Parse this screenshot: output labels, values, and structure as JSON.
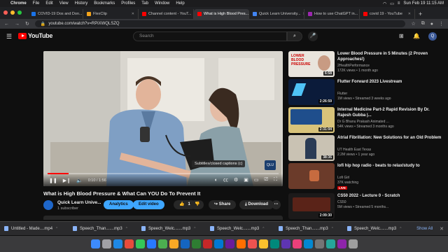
{
  "menubar": {
    "app": "Chrome",
    "items": [
      "File",
      "Edit",
      "View",
      "History",
      "Bookmarks",
      "Profiles",
      "Tab",
      "Window",
      "Help"
    ],
    "clock": "Sun Feb 19  11:15 AM"
  },
  "tabs": [
    {
      "label": "COVID-19 Dos and Don...",
      "color": "#1a73e8"
    },
    {
      "label": "FlexClip",
      "color": "#f3a31b"
    },
    {
      "label": "Channel content - YouT...",
      "color": "#ff0000"
    },
    {
      "label": "What is High Blood Pres...",
      "color": "#ff0000",
      "active": true
    },
    {
      "label": "Quick Learn University...",
      "color": "#4285f4"
    },
    {
      "label": "How to use ChatGPT in...",
      "color": "#9c27b0"
    },
    {
      "label": "covid 19 - YouTube",
      "color": "#ff0000"
    }
  ],
  "address": {
    "url": "youtube.com/watch?v=RPiXWQLSZQ"
  },
  "youtube": {
    "logo_text": "YouTube",
    "search_placeholder": "Search"
  },
  "player": {
    "time": "0:10 / 1:56",
    "progress": 0.09,
    "tooltip": "Subtitles/closed captions (c)",
    "corner_logo": "QLU"
  },
  "video": {
    "title": "What is High Blood Pressure & What Can YOU Do To Prevent It",
    "channel": "Quick Learn Unive...",
    "subscribers": "1 subscriber",
    "analytics_label": "Analytics",
    "edit_label": "Edit video",
    "likes": "1",
    "share_label": "Share",
    "download_label": "Download"
  },
  "recommendations": [
    {
      "title": "Lower Blood Pressure in 5 Minutes (2 Proven Approaches!)",
      "channel": "2HealthPerformance",
      "meta": "172K views • 1 month ago",
      "duration": "6:58",
      "thumb": "#e9e4dc"
    },
    {
      "title": "Flutter Forward 2023 Livestream",
      "channel": "Flutter",
      "meta": "1M views • Streamed 3 weeks ago",
      "duration": "2:26:59",
      "thumb": "#0b1b3a"
    },
    {
      "title": "Internal Medicine Part-2 Rapid Revision By Dr. Rajesh Gubba |...",
      "channel": "Dr G Bhanu Prakash Animated ...",
      "meta": "54K views • Streamed 3 months ago",
      "duration": "2:31:04",
      "thumb": "#d8c37a"
    },
    {
      "title": "Atrial Fibrillation: New Solutions for an Old Problem",
      "channel": "UT Health East Texas",
      "meta": "2.2M views • 1 year ago",
      "duration": "38:36",
      "thumb": "#c9c2b3"
    },
    {
      "title": "lofi hip hop radio - beats to relax/study to",
      "channel": "Lofi Girl",
      "meta": "37K watching",
      "live": "LIVE",
      "thumb": "#6b3b2a"
    },
    {
      "title": "CS50 2022 - Lecture 0 - Scratch",
      "channel": "CS50",
      "meta": "5M views • Streamed 5 months...",
      "duration": "2:09:30",
      "thumb": "#1c1a1a"
    }
  ],
  "downloads": {
    "items": [
      "Untitled - Made....mp4",
      "Speech_Than.......mp3",
      "Speech_Welc.......mp3",
      "Speech_Welc.......mp3",
      "Speech_Than.......mp3",
      "Speech_Welc.......mp3"
    ],
    "show_all": "Show All"
  }
}
